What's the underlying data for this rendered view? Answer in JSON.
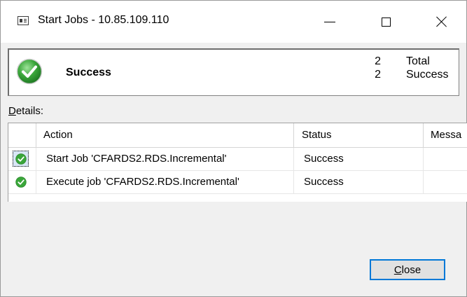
{
  "window": {
    "title": "Start Jobs - 10.85.109.110"
  },
  "summary": {
    "status_text": "Success",
    "total_count": "2",
    "total_label": "Total",
    "success_count": "2",
    "success_label": "Success"
  },
  "details": {
    "label": "Details:",
    "columns": [
      "Action",
      "Status",
      "Messa"
    ],
    "rows": [
      {
        "action": "Start Job 'CFARDS2.RDS.Incremental'",
        "status": "Success",
        "message": ""
      },
      {
        "action": "Execute job 'CFARDS2.RDS.Incremental'",
        "status": "Success",
        "message": ""
      }
    ]
  },
  "buttons": {
    "close_label": "Close"
  },
  "colors": {
    "success_green": "#3aa63a",
    "focus_blue": "#0078d7"
  }
}
